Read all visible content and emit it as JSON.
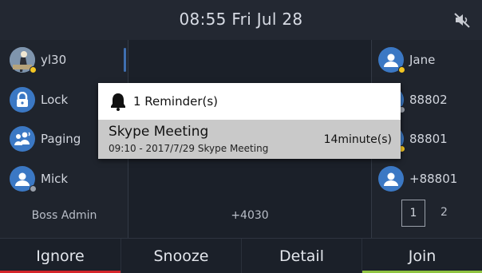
{
  "status_bar": {
    "time_date": "08:55 Fri Jul 28",
    "mute_icon": "speaker-muted-icon"
  },
  "left_keys": [
    {
      "label": "yl30",
      "icon": "avatar-photo-icon",
      "status_color": "#f3c623"
    },
    {
      "label": "Lock",
      "icon": "lock-icon"
    },
    {
      "label": "Paging",
      "icon": "paging-icon"
    },
    {
      "label": "Mick",
      "icon": "contact-icon",
      "status_color": "#9aa0aa"
    }
  ],
  "right_keys": [
    {
      "label": "Jane",
      "icon": "contact-icon",
      "status_color": "#f3c623"
    },
    {
      "label": "88802",
      "icon": "contact-icon",
      "status_color": "#9aa0aa"
    },
    {
      "label": "88801",
      "icon": "contact-icon",
      "status_color": "#f3c623"
    },
    {
      "label": "+88801",
      "icon": "contact-icon"
    }
  ],
  "account_name": "Boss Admin",
  "extension": "+4030",
  "pagination": {
    "current": "1",
    "next": "2"
  },
  "reminder": {
    "title": "1 Reminder(s)",
    "icon": "bell-icon",
    "item": {
      "subject": "Skype Meeting",
      "detail": "09:10 - 2017/7/29 Skype Meeting",
      "remaining": "14minute(s)"
    }
  },
  "softkeys": [
    "Ignore",
    "Snooze",
    "Detail",
    "Join"
  ],
  "colors": {
    "ignore_bar": "#d4262a",
    "join_bar": "#8fc341",
    "key_icon": "#3b78c4"
  }
}
